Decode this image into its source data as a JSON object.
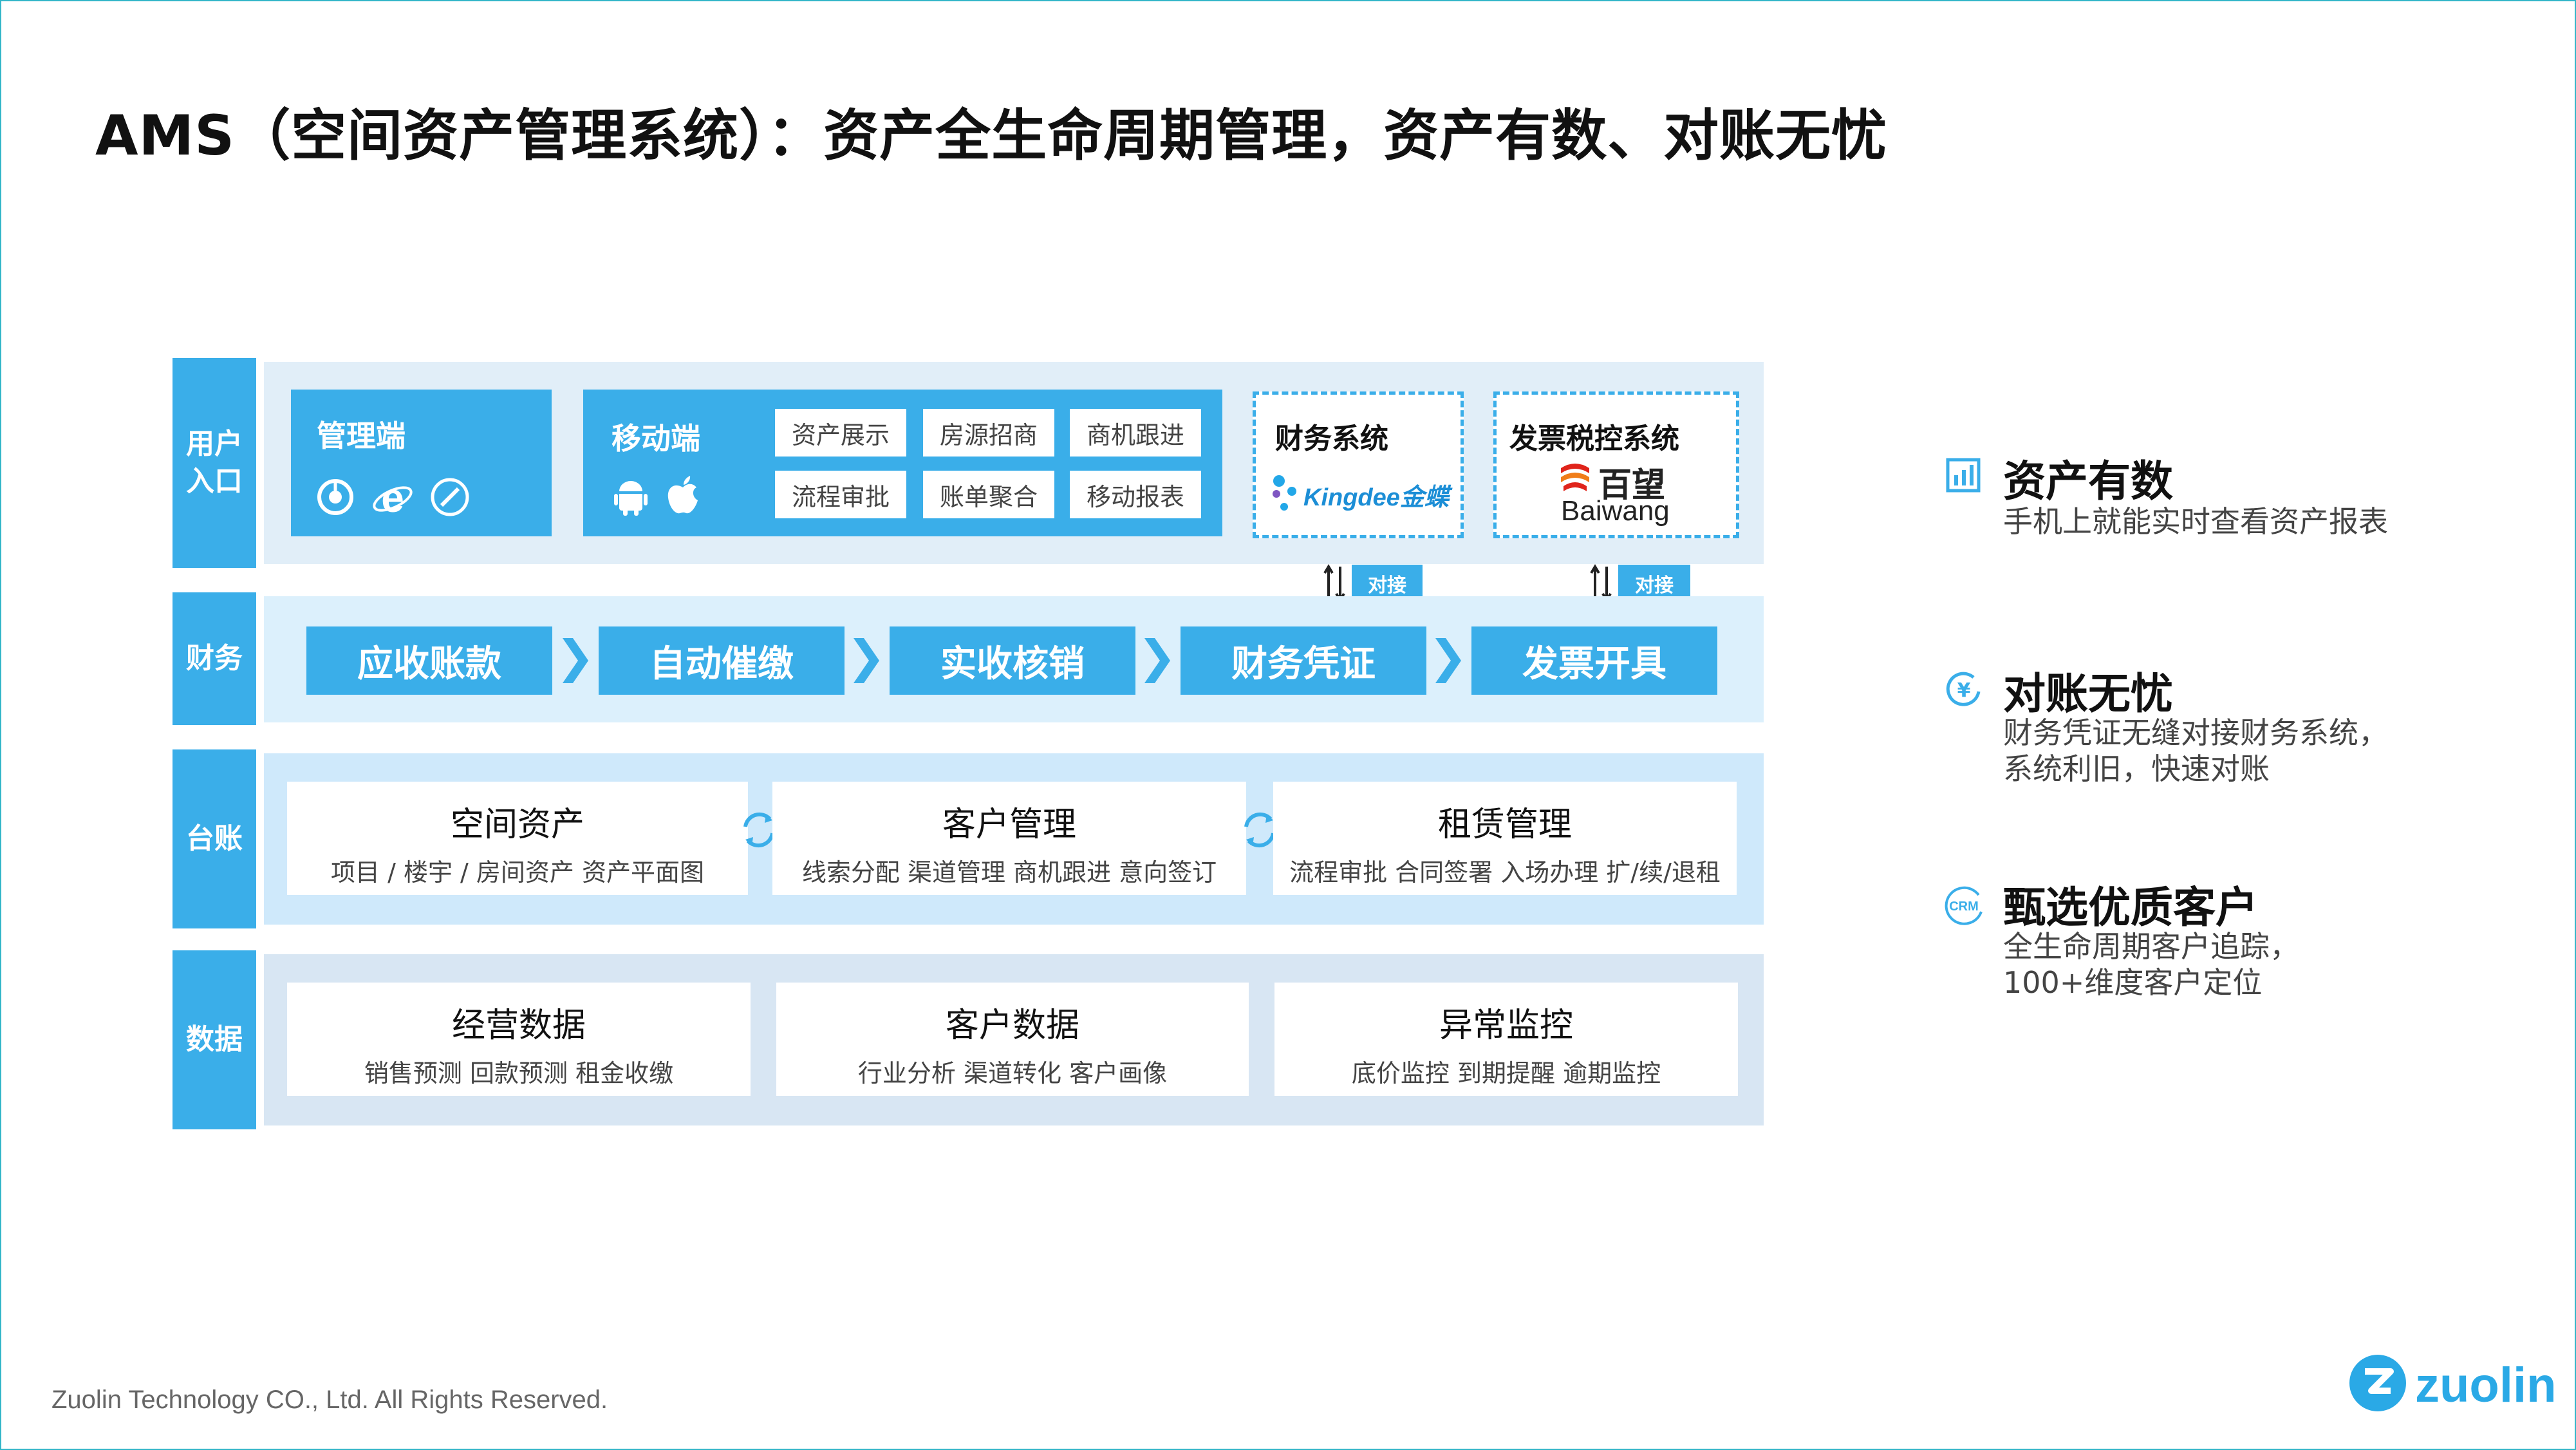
{
  "title": "AMS（空间资产管理系统）：资产全生命周期管理，资产有数、对账无忧",
  "rows": {
    "entry": "用户\n入口",
    "finance": "财务",
    "ledger": "台账",
    "data": "数据"
  },
  "entry": {
    "admin_label": "管理端",
    "mobile_label": "移动端",
    "mobile_chips": [
      "资产展示",
      "房源招商",
      "商机跟进",
      "流程审批",
      "账单聚合",
      "移动报表"
    ],
    "finance_system": {
      "title": "财务系统",
      "brand": "Kingdee金蝶"
    },
    "invoice_system": {
      "title": "发票税控系统",
      "brand_cn": "百望",
      "brand_en": "Baiwang"
    },
    "connect_label": "对接"
  },
  "finance_steps": [
    "应收账款",
    "自动催缴",
    "实收核销",
    "财务凭证",
    "发票开具"
  ],
  "ledger_cards": [
    {
      "title": "空间资产",
      "sub": "项目 / 楼宇 / 房间资产 资产平面图"
    },
    {
      "title": "客户管理",
      "sub": "线索分配  渠道管理  商机跟进  意向签订"
    },
    {
      "title": "租赁管理",
      "sub": "流程审批 合同签署 入场办理 扩/续/退租"
    }
  ],
  "data_cards": [
    {
      "title": "经营数据",
      "sub": "销售预测    回款预测    租金收缴"
    },
    {
      "title": "客户数据",
      "sub": "行业分析    渠道转化    客户画像"
    },
    {
      "title": "异常监控",
      "sub": "底价监控    到期提醒    逾期监控"
    }
  ],
  "features": [
    {
      "icon": "chart-icon",
      "title": "资产有数",
      "desc": "手机上就能实时查看资产报表"
    },
    {
      "icon": "yen-icon",
      "title": "对账无忧",
      "desc": "财务凭证无缝对接财务系统，系统利旧，快速对账"
    },
    {
      "icon": "crm-icon",
      "title": "甄选优质客户",
      "desc": "全生命周期客户追踪，100+维度客户定位"
    }
  ],
  "footer": "Zuolin Technology CO., Ltd. All Rights Reserved.",
  "logo": "zuolin",
  "colors": {
    "accent": "#3aaee9",
    "panel_light": "#e1eef8",
    "panel_blue": "#cfe9fb",
    "frame": "#33b6c8"
  }
}
